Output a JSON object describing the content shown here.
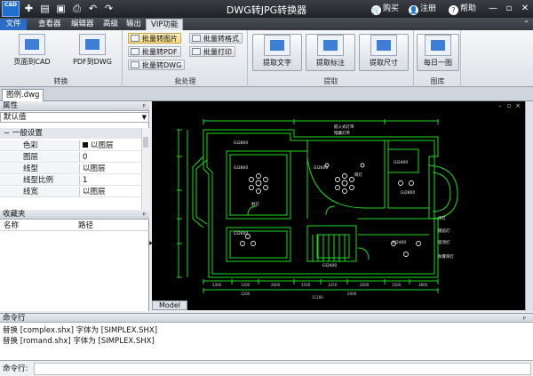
{
  "window": {
    "title": "DWG转JPG转换器",
    "logo_text": "CAD",
    "quick_access_icons": [
      "new-icon",
      "open-icon",
      "save-icon",
      "print-icon",
      "undo-icon",
      "redo-icon"
    ],
    "purchase_label": "购买",
    "register_label": "注册",
    "help_label": "帮助",
    "help_icon_glyph": "?"
  },
  "menu": {
    "file": "文件",
    "tabs": [
      "查看器",
      "编辑器",
      "高级",
      "输出",
      "VIP功能"
    ],
    "active_tab": "VIP功能"
  },
  "ribbon": {
    "groups": {
      "convert": "转换",
      "batch": "批处理",
      "extract": "提取",
      "library": "图库"
    },
    "buttons": {
      "page_to_cad": "页面到CAD",
      "pdf_to_dwg": "PDF到DWG",
      "batch_to_image": "批量转图片",
      "batch_to_pdf": "批量转PDF",
      "batch_to_dwg": "批量转DWG",
      "batch_to_format": "批量转格式",
      "batch_print": "批量打印",
      "extract_text": "提取文字",
      "extract_annotation": "提取标注",
      "extract_dimension": "提取尺寸",
      "daily_drawing": "每日一图"
    }
  },
  "document": {
    "tab": "图例.dwg",
    "model_tab": "Model"
  },
  "properties": {
    "title": "属性",
    "pin_glyph": "ᵖ",
    "selected": "默认值",
    "section": "一般设置",
    "section_toggle": "−",
    "rows": [
      {
        "key": "色彩",
        "value": "以图层"
      },
      {
        "key": "图层",
        "value": "0"
      },
      {
        "key": "线型",
        "value": "以图层"
      },
      {
        "key": "线型比例",
        "value": "1"
      },
      {
        "key": "线宽",
        "value": "以图层"
      }
    ]
  },
  "favorites": {
    "title": "收藏夹",
    "columns": [
      "名称",
      "路径"
    ]
  },
  "cad": {
    "room_labels": [
      "GI2800",
      "GI2600",
      "GI2400",
      "GI2800",
      "GI2600",
      "GI2400",
      "GI2800",
      "GI2400"
    ],
    "notes": [
      "嵌入式灯带",
      "暗藏灯带",
      "筒灯",
      "射灯",
      "镜前灯",
      "吸顶灯",
      "吊灯",
      "防雾筒灯"
    ],
    "dims": [
      "2400",
      "1200",
      "2600",
      "1500",
      "1250",
      "2600",
      "1500",
      "3800",
      "1200",
      "2000",
      "11160"
    ]
  },
  "command": {
    "title": "命令行",
    "pin_glyph": "ᵖ",
    "log": [
      "替换 [complex.shx] 字体为 [SIMPLEX.SHX]",
      "替换 [romand.shx] 字体为 [SIMPLEX.SHX]"
    ],
    "input_label": "命令行:",
    "input_value": ""
  }
}
